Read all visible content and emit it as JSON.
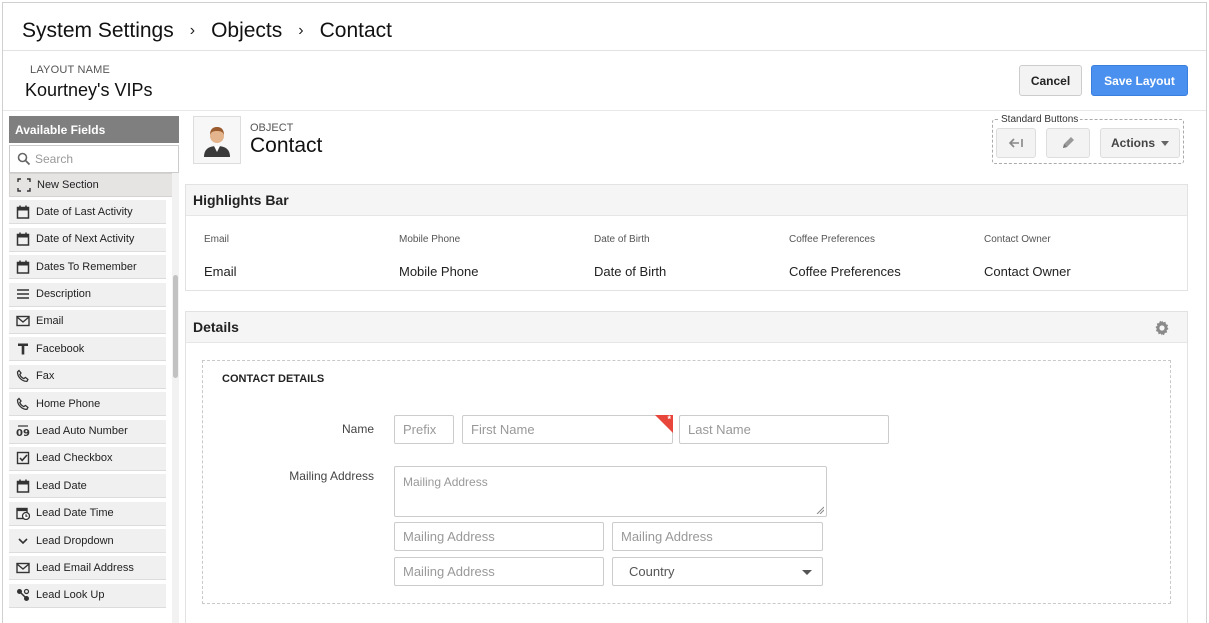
{
  "breadcrumb": {
    "items": [
      "System Settings",
      "Objects",
      "Contact"
    ],
    "separator": "›"
  },
  "layout": {
    "label": "LAYOUT NAME",
    "name": "Kourtney's VIPs"
  },
  "actions": {
    "cancel": "Cancel",
    "save": "Save Layout",
    "save_color": "#4a90ee"
  },
  "sidebar": {
    "title": "Available Fields",
    "search_placeholder": "Search",
    "items": [
      {
        "label": "New Section",
        "icon": "section-icon"
      },
      {
        "label": "Date of Last Activity",
        "icon": "calendar-icon"
      },
      {
        "label": "Date of Next Activity",
        "icon": "calendar-icon"
      },
      {
        "label": "Dates To Remember",
        "icon": "calendar-icon"
      },
      {
        "label": "Description",
        "icon": "text-lines-icon"
      },
      {
        "label": "Email",
        "icon": "envelope-icon"
      },
      {
        "label": "Facebook",
        "icon": "text-t-icon"
      },
      {
        "label": "Fax",
        "icon": "phone-icon"
      },
      {
        "label": "Home Phone",
        "icon": "phone-icon"
      },
      {
        "label": "Lead Auto Number",
        "icon": "auto-number-icon"
      },
      {
        "label": "Lead Checkbox",
        "icon": "checkbox-icon"
      },
      {
        "label": "Lead Date",
        "icon": "calendar-icon"
      },
      {
        "label": "Lead Date Time",
        "icon": "calendar-clock-icon"
      },
      {
        "label": "Lead Dropdown",
        "icon": "chevron-down-icon"
      },
      {
        "label": "Lead Email Address",
        "icon": "envelope-icon"
      },
      {
        "label": "Lead Look Up",
        "icon": "lookup-icon"
      }
    ]
  },
  "object": {
    "label": "OBJECT",
    "name": "Contact"
  },
  "standard_buttons": {
    "label": "Standard Buttons",
    "actions": "Actions"
  },
  "highlights": {
    "title": "Highlights Bar",
    "columns": [
      {
        "label": "Email",
        "value": "Email"
      },
      {
        "label": "Mobile Phone",
        "value": "Mobile Phone"
      },
      {
        "label": "Date of Birth",
        "value": "Date of Birth"
      },
      {
        "label": "Coffee Preferences",
        "value": "Coffee Preferences"
      },
      {
        "label": "Contact Owner",
        "value": "Contact Owner"
      }
    ]
  },
  "details": {
    "title": "Details",
    "section_title": "CONTACT DETAILS",
    "name_label": "Name",
    "prefix_placeholder": "Prefix",
    "first_name_placeholder": "First Name",
    "last_name_placeholder": "Last Name",
    "required_mark": "*",
    "mailing_label": "Mailing Address",
    "mailing_placeholder": "Mailing Address",
    "country_placeholder": "Country"
  }
}
